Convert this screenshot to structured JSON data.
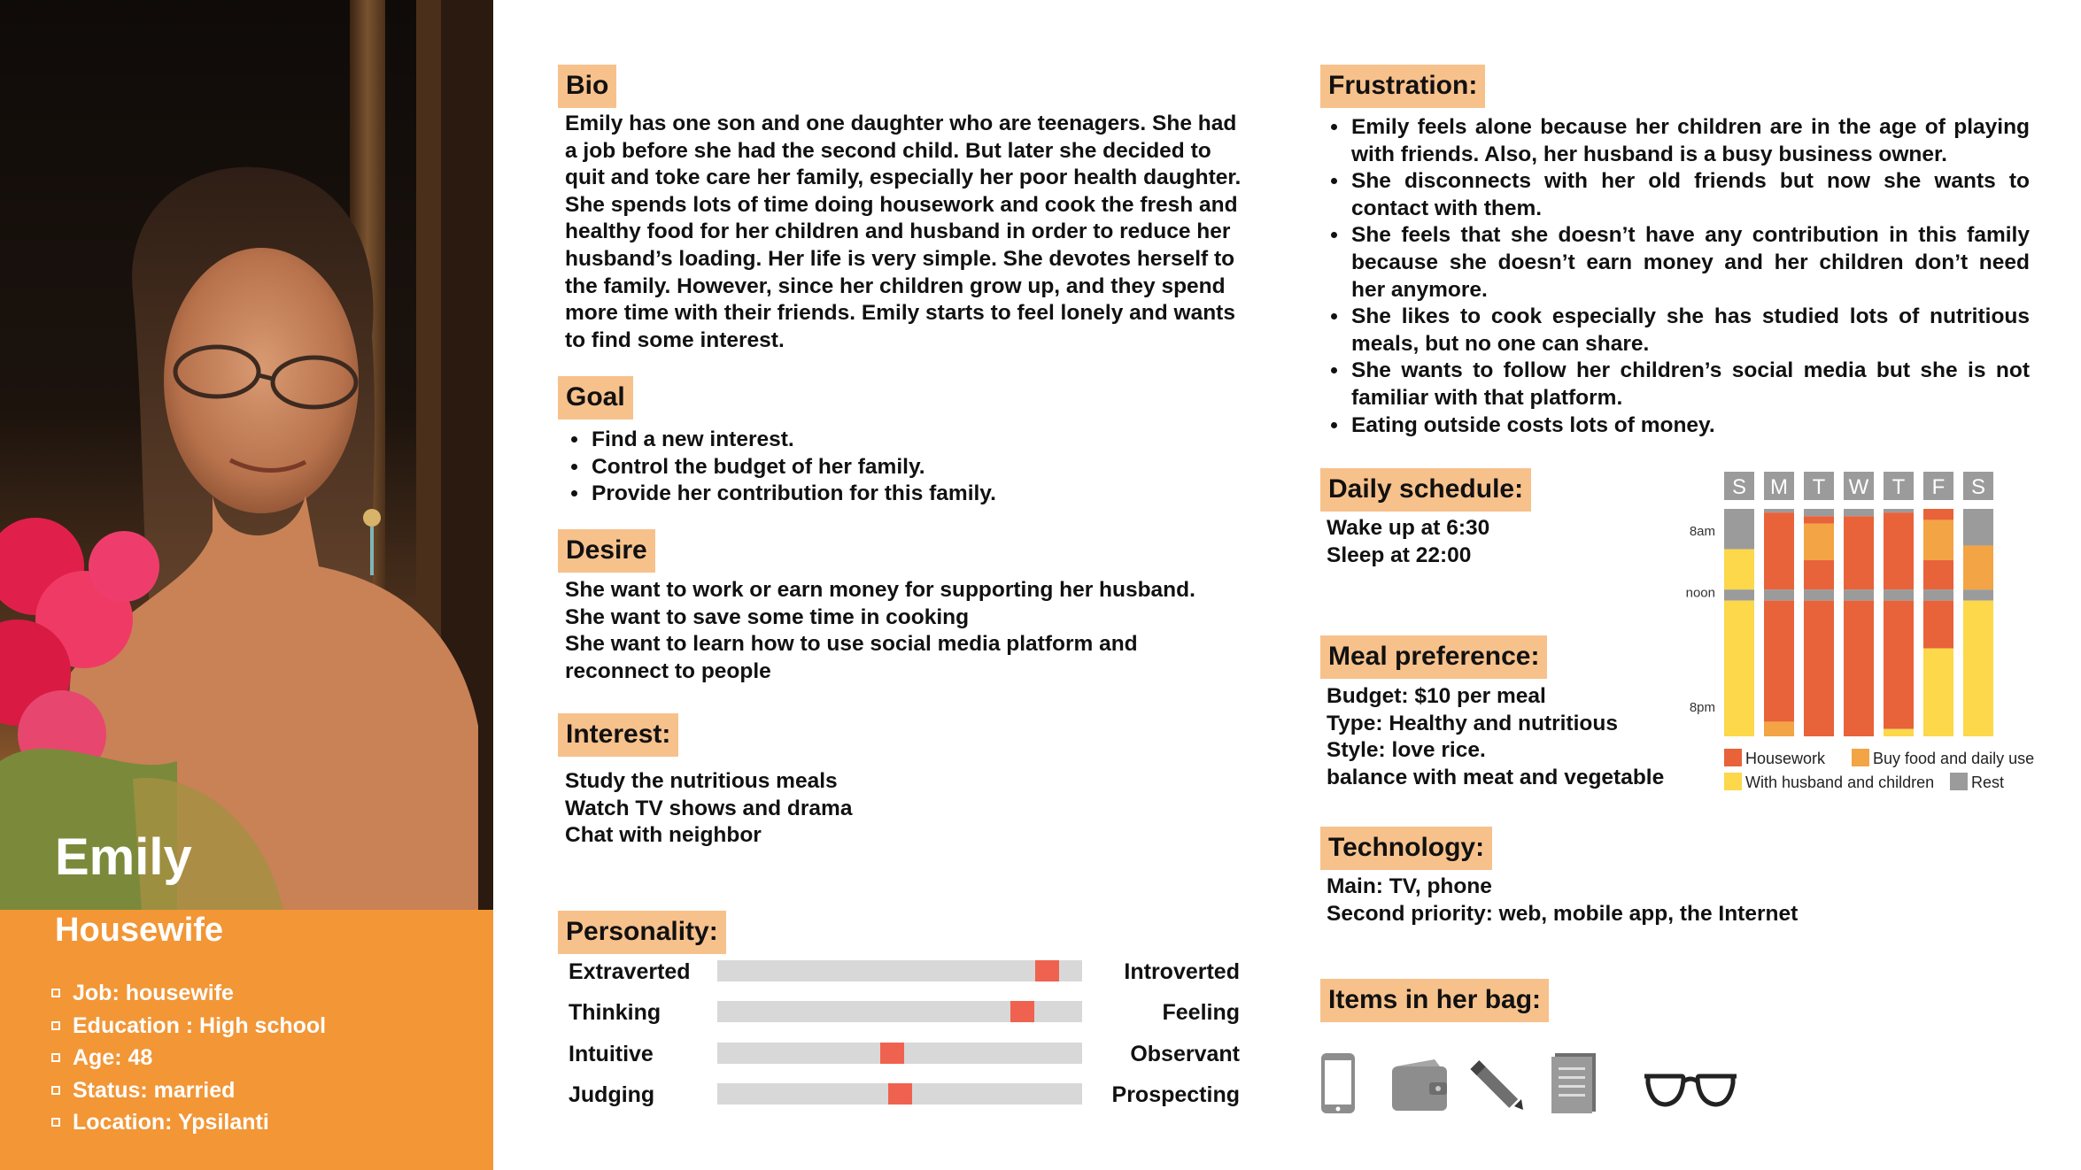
{
  "persona": {
    "name": "Emily",
    "role": "Housewife",
    "facts": [
      "Job: housewife",
      "Education : High school",
      "Age: 48",
      "Status: married",
      "Location: Ypsilanti"
    ]
  },
  "bio": {
    "heading": "Bio",
    "lines": [
      "Emily has one son and one daughter who are teenagers. She had",
      "a job before she had the second child. But later she decided to",
      "quit and toke care her family, especially her poor health daughter.",
      "She spends lots of time doing housework and cook the fresh and",
      "healthy food for her children and husband in order to reduce her",
      "husband’s loading. Her life is very simple. She devotes herself to",
      "the family. However, since her children grow up, and they spend",
      "more time with their friends. Emily starts to feel lonely and wants",
      "to find some interest."
    ]
  },
  "goal": {
    "heading": "Goal",
    "items": [
      "Find a new interest.",
      "Control the budget of her family.",
      "Provide her contribution for this family."
    ]
  },
  "desire": {
    "heading": "Desire",
    "lines": [
      "She want to  work or earn money for supporting her husband.",
      "She want to save some time in cooking",
      "She want to learn how to use social media platform and",
      "reconnect to people"
    ]
  },
  "interest": {
    "heading": "Interest:",
    "lines": [
      "Study the nutritious meals",
      "Watch TV shows and drama",
      "Chat with neighbor"
    ]
  },
  "personality": {
    "heading": "Personality:",
    "traits": [
      {
        "left": "Extraverted",
        "right": "Introverted",
        "value": 0.905
      },
      {
        "left": "Thinking",
        "right": "Feeling",
        "value": 0.835
      },
      {
        "left": "Intuitive",
        "right": "Observant",
        "value": 0.48
      },
      {
        "left": "Judging",
        "right": "Prospecting",
        "value": 0.5
      }
    ]
  },
  "frustration": {
    "heading": "Frustration:",
    "items": [
      [
        "Emily feels alone because her children are in the age of playing",
        "with friends. Also, her husband is a busy business owner."
      ],
      [
        "She disconnects with her old friends but now she wants to",
        "contact with them."
      ],
      [
        "She feels that she doesn’t have any contribution in this family",
        "because she doesn’t earn money and her children don’t need",
        "her anymore."
      ],
      [
        "She likes to cook especially she has studied lots of nutritious",
        "meals, but no one can share."
      ],
      [
        "She wants to follow her children’s social media but she is not",
        "familiar with that platform."
      ],
      [
        "Eating outside costs lots of money."
      ]
    ]
  },
  "daily_schedule": {
    "heading": "Daily schedule:",
    "lines": [
      "Wake up at 6:30",
      "Sleep at 22:00"
    ]
  },
  "meal_preference": {
    "heading": "Meal preference:",
    "lines": [
      "Budget: $10 per meal",
      "Type: Healthy and nutritious",
      "Style: love rice.",
      "balance with meat and vegetable"
    ]
  },
  "technology": {
    "heading": "Technology:",
    "lines": [
      "Main: TV, phone",
      "Second priority: web, mobile app, the Internet"
    ]
  },
  "bag": {
    "heading": "Items in her bag:",
    "icons": [
      "phone-icon",
      "wallet-icon",
      "pencil-icon",
      "notebook-icon",
      "glasses-icon"
    ]
  },
  "chart_data": {
    "type": "bar",
    "orientation": "vertical-stacked",
    "categories": [
      "S",
      "M",
      "T",
      "W",
      "T",
      "F",
      "S"
    ],
    "y_tick_labels": [
      "8am",
      "noon",
      "8pm"
    ],
    "y_range_hours": [
      6.5,
      22
    ],
    "colors": {
      "Housework": "#e8623a",
      "Buy food and daily use": "#f3a444",
      "With husband and children": "#fcd84a",
      "Rest": "#9b9b9b"
    },
    "legend": [
      "Housework",
      "Buy food and daily use",
      "With husband and children",
      "Rest"
    ],
    "days": [
      [
        [
          "Rest",
          6.5,
          9.25
        ],
        [
          "With husband and children",
          9.25,
          12.0
        ],
        [
          "Rest",
          12.0,
          12.75
        ],
        [
          "With husband and children",
          12.75,
          22.0
        ]
      ],
      [
        [
          "Rest",
          6.5,
          6.75
        ],
        [
          "Housework",
          6.75,
          12.0
        ],
        [
          "Rest",
          12.0,
          12.75
        ],
        [
          "Housework",
          12.75,
          21.0
        ],
        [
          "Buy food and daily use",
          21.0,
          22.0
        ]
      ],
      [
        [
          "Rest",
          6.5,
          7.0
        ],
        [
          "Housework",
          7.0,
          7.5
        ],
        [
          "Buy food and daily use",
          7.5,
          10.0
        ],
        [
          "Housework",
          10.0,
          12.0
        ],
        [
          "Rest",
          12.0,
          12.75
        ],
        [
          "Housework",
          12.75,
          22.0
        ]
      ],
      [
        [
          "Rest",
          6.5,
          7.0
        ],
        [
          "Housework",
          7.0,
          12.0
        ],
        [
          "Rest",
          12.0,
          12.75
        ],
        [
          "Housework",
          12.75,
          22.0
        ]
      ],
      [
        [
          "Rest",
          6.5,
          6.75
        ],
        [
          "Housework",
          6.75,
          12.0
        ],
        [
          "Rest",
          12.0,
          12.75
        ],
        [
          "Housework",
          12.75,
          21.5
        ],
        [
          "With husband and children",
          21.5,
          22.0
        ]
      ],
      [
        [
          "Housework",
          6.5,
          7.25
        ],
        [
          "Buy food and daily use",
          7.25,
          10.0
        ],
        [
          "Housework",
          10.0,
          12.0
        ],
        [
          "Rest",
          12.0,
          12.75
        ],
        [
          "Housework",
          12.75,
          14.25
        ],
        [
          "Housework",
          14.25,
          16.0
        ],
        [
          "With husband and children",
          16.0,
          22.0
        ]
      ],
      [
        [
          "Rest",
          6.5,
          9.0
        ],
        [
          "Buy food and daily use",
          9.0,
          12.0
        ],
        [
          "Rest",
          12.0,
          12.75
        ],
        [
          "With husband and children",
          12.75,
          22.0
        ]
      ]
    ]
  }
}
